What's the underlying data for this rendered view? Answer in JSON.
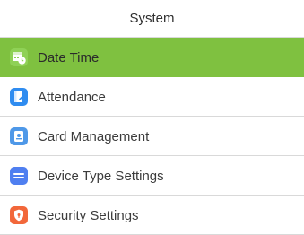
{
  "header": {
    "title": "System"
  },
  "menu": {
    "items": [
      {
        "label": "Date Time",
        "icon": "calendar-clock-icon",
        "selected": true,
        "color": "#8fd156"
      },
      {
        "label": "Attendance",
        "icon": "attendance-book-icon",
        "selected": false,
        "color": "#2f8cf0"
      },
      {
        "label": "Card Management",
        "icon": "card-icon",
        "selected": false,
        "color": "#4e98e8"
      },
      {
        "label": "Device Type Settings",
        "icon": "device-type-icon",
        "selected": false,
        "color": "#4f7ff0"
      },
      {
        "label": "Security Settings",
        "icon": "shield-icon",
        "selected": false,
        "color": "#f2673a"
      }
    ]
  },
  "colors": {
    "selected_background": "#7fc140",
    "divider": "#d9d9d9"
  }
}
